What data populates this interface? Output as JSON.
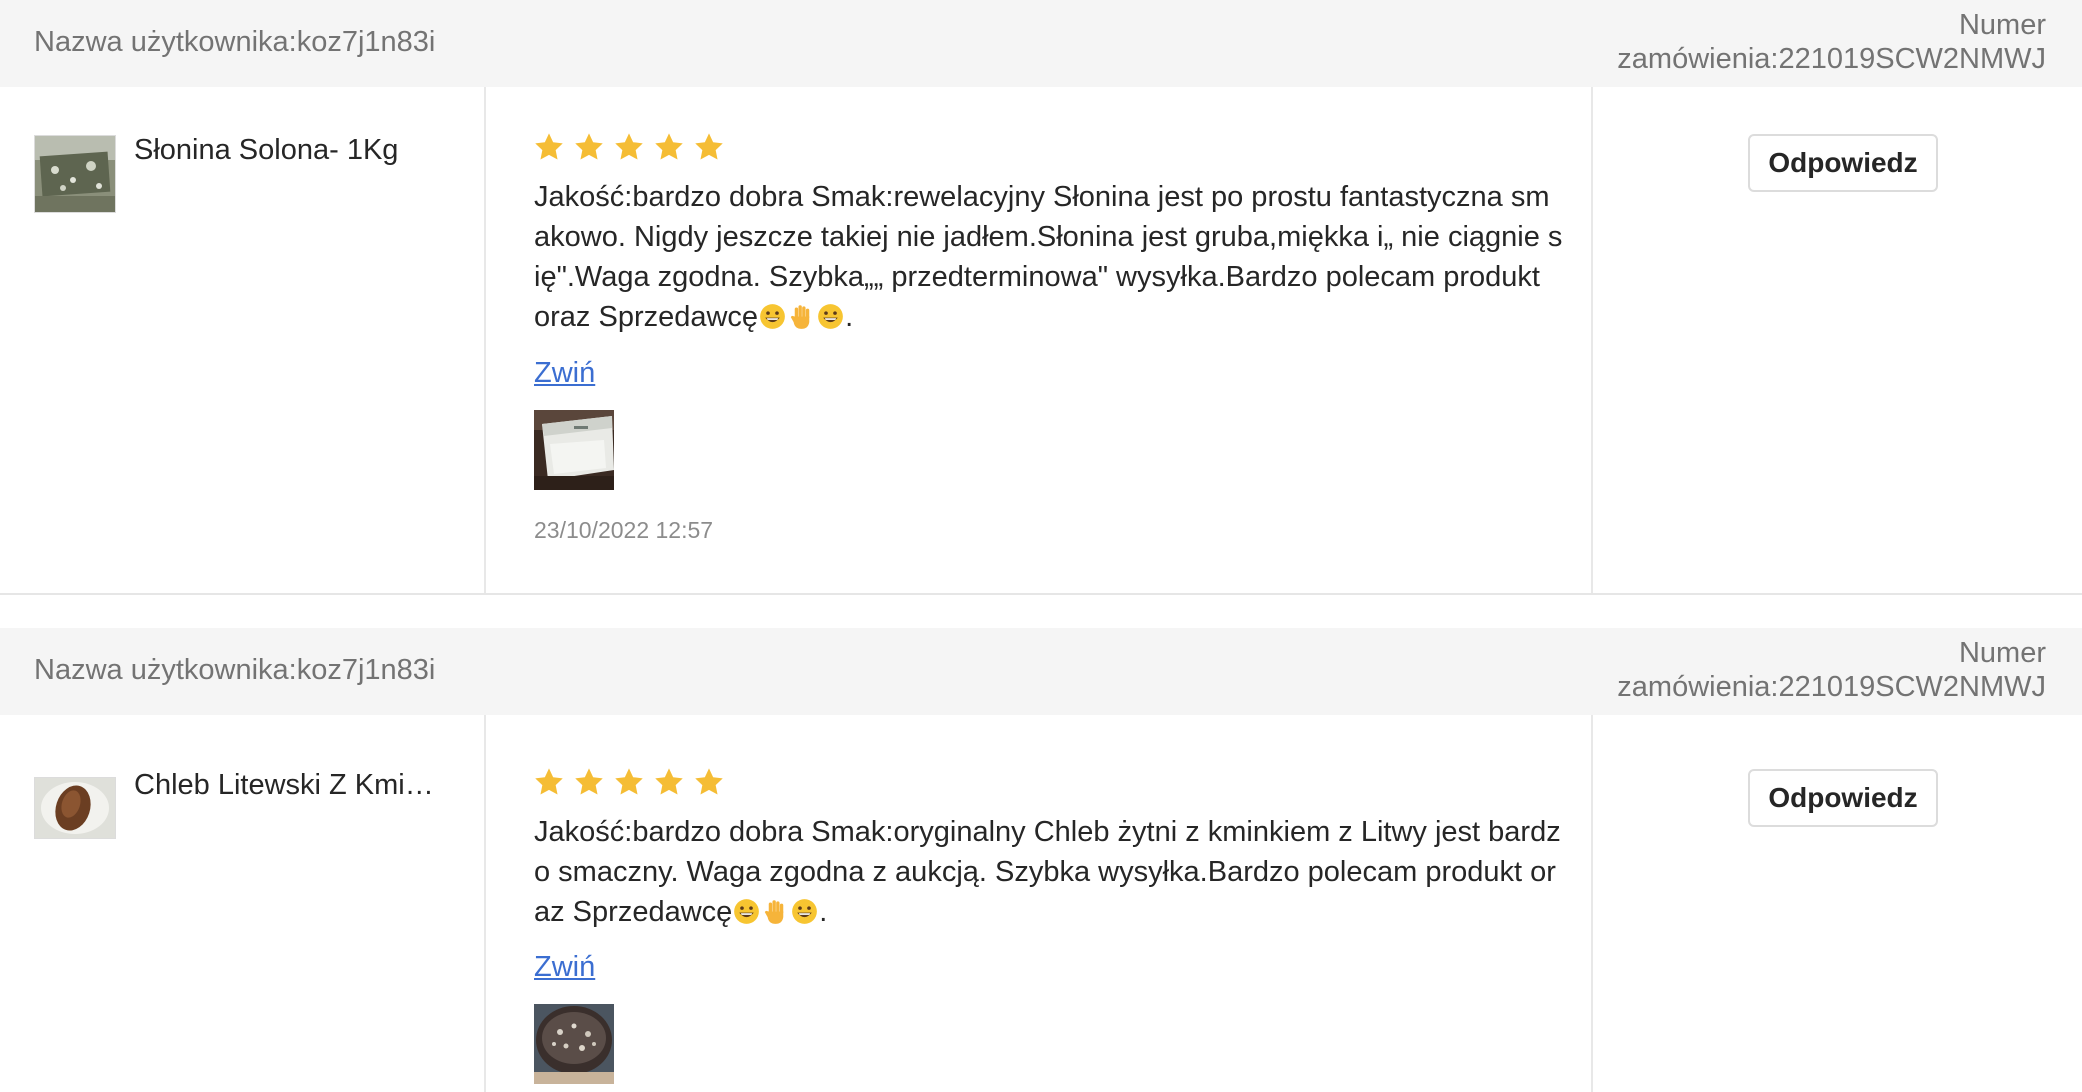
{
  "reviews": [
    {
      "username": "Nazwa użytkownika:koz7j1n83i",
      "order_label": "Numer",
      "order_value": "zamówienia:221019SCW2NMWJ",
      "product_name": "Słonina Solona- 1Kg",
      "rating": 5,
      "text": "Jakość:bardzo dobra Smak:rewelacyjny Słonina jest po prostu fantastyczna smakowo. Nigdy jeszcze takiej nie jadłem.Słonina jest gruba,miękka i„ nie ciągnie się\".Waga zgodna. Szybka„„ przedterminowa\" wysyłka.Bardzo polecam produkt oraz Sprzedawcę",
      "emoji": [
        "grinning-face-icon",
        "raised-hand-icon",
        "grinning-face-icon"
      ],
      "text_end": ".",
      "toggle_label": "Zwiń",
      "date": "23/10/2022 12:57",
      "reply_label": "Odpowiedz"
    },
    {
      "username": "Nazwa użytkownika:koz7j1n83i",
      "order_label": "Numer",
      "order_value": "zamówienia:221019SCW2NMWJ",
      "product_name": "Chleb Litewski Z Kminkiem",
      "rating": 5,
      "text": "Jakość:bardzo dobra Smak:oryginalny Chleb żytni z kminkiem z Litwy jest bardzo smaczny. Waga zgodna z aukcją. Szybka wysyłka.Bardzo polecam produkt oraz Sprzedawcę",
      "emoji": [
        "grinning-face-icon",
        "raised-hand-icon",
        "grinning-face-icon"
      ],
      "text_end": ".",
      "toggle_label": "Zwiń",
      "reply_label": "Odpowiedz"
    }
  ],
  "colors": {
    "header_bg": "#f5f5f5",
    "muted_text": "#737373",
    "star": "#f5bd35",
    "link": "#3b6ed1",
    "divider": "#e8e8e8"
  }
}
